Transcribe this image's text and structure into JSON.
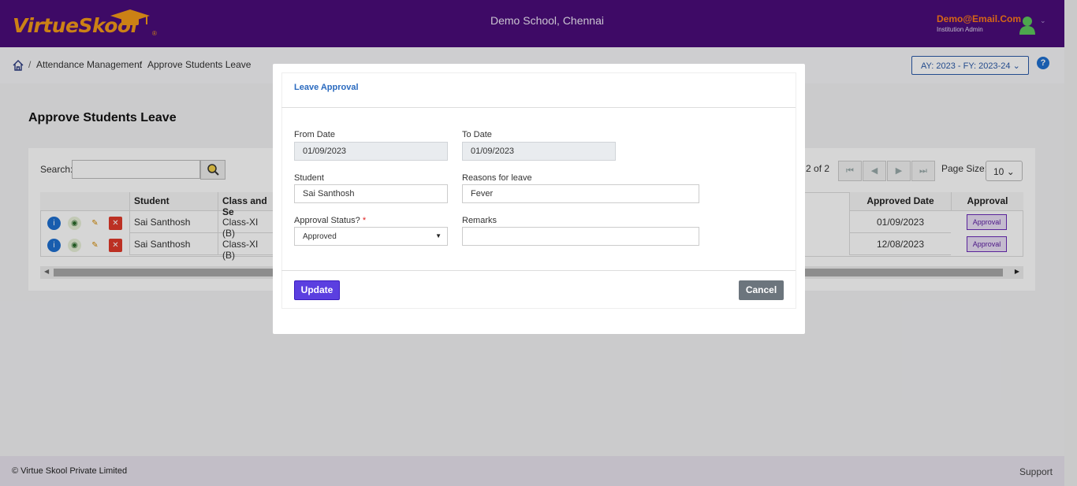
{
  "header": {
    "logo_virtue": "Virtue",
    "logo_skool": "Skool",
    "logo_reg": "®",
    "school_name": "Demo School, Chennai",
    "user_email": "Demo@Email.Com",
    "user_role": "Institution Admin"
  },
  "breadcrumb": {
    "sep": "/",
    "items": [
      "Attendance Management",
      "Approve Students Leave"
    ]
  },
  "ay_selector": "AY: 2023 - FY: 2023-24",
  "help_label": "?",
  "page": {
    "title": "Approve Students Leave",
    "search_label": "Search:",
    "search_value": "",
    "page_info": "o 2 of 2",
    "page_size_label": "Page Size:",
    "page_size_value": "10"
  },
  "grid": {
    "headers": [
      "Student",
      "Class and Se",
      "Approved Date",
      "Approval"
    ],
    "rows": [
      {
        "student": "Sai Santhosh",
        "class": "Class-XI (B)",
        "approved_date": "01/09/2023",
        "approval": "Approval"
      },
      {
        "student": "Sai Santhosh",
        "class": "Class-XI (B)",
        "approved_date": "12/08/2023",
        "approval": "Approval"
      }
    ]
  },
  "modal": {
    "title": "Leave Approval",
    "from_date_label": "From Date",
    "from_date_value": "01/09/2023",
    "to_date_label": "To Date",
    "to_date_value": "01/09/2023",
    "student_label": "Student",
    "student_value": "Sai Santhosh",
    "reason_label": "Reasons for leave",
    "reason_value": "Fever",
    "status_label": "Approval Status?",
    "status_required": "*",
    "status_value": "Approved",
    "remarks_label": "Remarks",
    "remarks_value": "",
    "update_label": "Update",
    "cancel_label": "Cancel"
  },
  "footer": {
    "copyright": "© Virtue Skool Private Limited",
    "support": "Support"
  },
  "colors": {
    "header_bg": "#4a0d7a",
    "brand_orange": "#f39a1a",
    "primary": "#5b3fe0",
    "link_blue": "#2a6abf"
  },
  "icons": [
    "graduation-cap-icon",
    "user-avatar-icon",
    "chevron-down-icon",
    "home-icon",
    "help-icon",
    "search-icon",
    "first-page-icon",
    "prev-page-icon",
    "next-page-icon",
    "last-page-icon",
    "info-icon",
    "view-icon",
    "edit-icon",
    "delete-icon"
  ]
}
